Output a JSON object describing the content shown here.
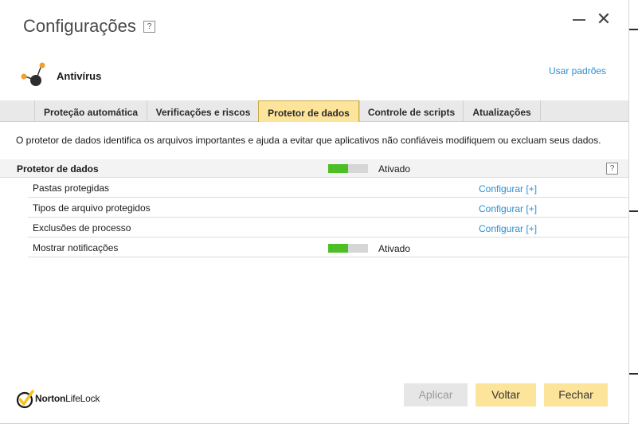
{
  "window": {
    "title": "Configurações",
    "help": "?"
  },
  "product": {
    "name": "Antivírus",
    "defaults_link": "Usar padrões"
  },
  "tabs": [
    {
      "label": "Proteção automática"
    },
    {
      "label": "Verificações e riscos"
    },
    {
      "label": "Protetor de dados",
      "active": true
    },
    {
      "label": "Controle de scripts"
    },
    {
      "label": "Atualizações"
    }
  ],
  "description": "O protetor de dados identifica os arquivos importantes e ajuda a evitar que aplicativos não confiáveis modifiquem ou excluam seus dados.",
  "section": {
    "title": "Protetor de dados",
    "status": "Ativado",
    "toggle_level": 0.5,
    "help": "?"
  },
  "rows": [
    {
      "label": "Pastas protegidas",
      "link": "Configurar [+]"
    },
    {
      "label": "Tipos de arquivo protegidos",
      "link": "Configurar [+]"
    },
    {
      "label": "Exclusões de processo",
      "link": "Configurar [+]"
    },
    {
      "label": "Mostrar notificações",
      "status": "Ativado",
      "toggle_level": 0.5
    }
  ],
  "brand": {
    "name_bold": "Norton",
    "name_light": "LifeLock"
  },
  "buttons": {
    "apply": "Aplicar",
    "back": "Voltar",
    "close": "Fechar"
  },
  "colors": {
    "accent": "#fde49b",
    "toggle_on": "#4cbf26",
    "link": "#2a8fd0"
  }
}
